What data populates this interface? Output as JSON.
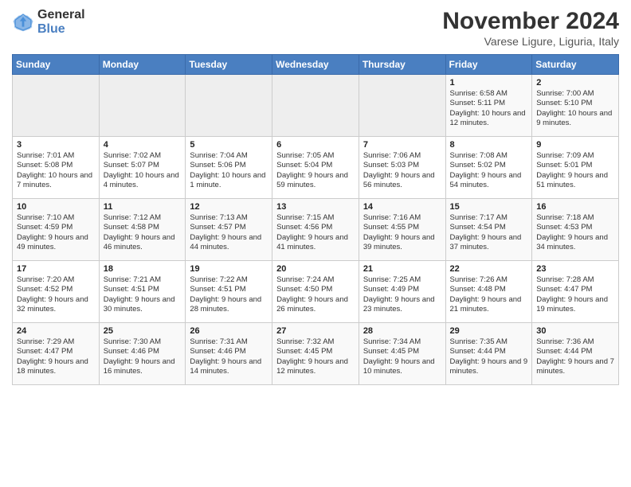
{
  "header": {
    "logo_line1": "General",
    "logo_line2": "Blue",
    "month": "November 2024",
    "location": "Varese Ligure, Liguria, Italy"
  },
  "days_of_week": [
    "Sunday",
    "Monday",
    "Tuesday",
    "Wednesday",
    "Thursday",
    "Friday",
    "Saturday"
  ],
  "weeks": [
    [
      {
        "day": "",
        "info": ""
      },
      {
        "day": "",
        "info": ""
      },
      {
        "day": "",
        "info": ""
      },
      {
        "day": "",
        "info": ""
      },
      {
        "day": "",
        "info": ""
      },
      {
        "day": "1",
        "info": "Sunrise: 6:58 AM\nSunset: 5:11 PM\nDaylight: 10 hours and 12 minutes."
      },
      {
        "day": "2",
        "info": "Sunrise: 7:00 AM\nSunset: 5:10 PM\nDaylight: 10 hours and 9 minutes."
      }
    ],
    [
      {
        "day": "3",
        "info": "Sunrise: 7:01 AM\nSunset: 5:08 PM\nDaylight: 10 hours and 7 minutes."
      },
      {
        "day": "4",
        "info": "Sunrise: 7:02 AM\nSunset: 5:07 PM\nDaylight: 10 hours and 4 minutes."
      },
      {
        "day": "5",
        "info": "Sunrise: 7:04 AM\nSunset: 5:06 PM\nDaylight: 10 hours and 1 minute."
      },
      {
        "day": "6",
        "info": "Sunrise: 7:05 AM\nSunset: 5:04 PM\nDaylight: 9 hours and 59 minutes."
      },
      {
        "day": "7",
        "info": "Sunrise: 7:06 AM\nSunset: 5:03 PM\nDaylight: 9 hours and 56 minutes."
      },
      {
        "day": "8",
        "info": "Sunrise: 7:08 AM\nSunset: 5:02 PM\nDaylight: 9 hours and 54 minutes."
      },
      {
        "day": "9",
        "info": "Sunrise: 7:09 AM\nSunset: 5:01 PM\nDaylight: 9 hours and 51 minutes."
      }
    ],
    [
      {
        "day": "10",
        "info": "Sunrise: 7:10 AM\nSunset: 4:59 PM\nDaylight: 9 hours and 49 minutes."
      },
      {
        "day": "11",
        "info": "Sunrise: 7:12 AM\nSunset: 4:58 PM\nDaylight: 9 hours and 46 minutes."
      },
      {
        "day": "12",
        "info": "Sunrise: 7:13 AM\nSunset: 4:57 PM\nDaylight: 9 hours and 44 minutes."
      },
      {
        "day": "13",
        "info": "Sunrise: 7:15 AM\nSunset: 4:56 PM\nDaylight: 9 hours and 41 minutes."
      },
      {
        "day": "14",
        "info": "Sunrise: 7:16 AM\nSunset: 4:55 PM\nDaylight: 9 hours and 39 minutes."
      },
      {
        "day": "15",
        "info": "Sunrise: 7:17 AM\nSunset: 4:54 PM\nDaylight: 9 hours and 37 minutes."
      },
      {
        "day": "16",
        "info": "Sunrise: 7:18 AM\nSunset: 4:53 PM\nDaylight: 9 hours and 34 minutes."
      }
    ],
    [
      {
        "day": "17",
        "info": "Sunrise: 7:20 AM\nSunset: 4:52 PM\nDaylight: 9 hours and 32 minutes."
      },
      {
        "day": "18",
        "info": "Sunrise: 7:21 AM\nSunset: 4:51 PM\nDaylight: 9 hours and 30 minutes."
      },
      {
        "day": "19",
        "info": "Sunrise: 7:22 AM\nSunset: 4:51 PM\nDaylight: 9 hours and 28 minutes."
      },
      {
        "day": "20",
        "info": "Sunrise: 7:24 AM\nSunset: 4:50 PM\nDaylight: 9 hours and 26 minutes."
      },
      {
        "day": "21",
        "info": "Sunrise: 7:25 AM\nSunset: 4:49 PM\nDaylight: 9 hours and 23 minutes."
      },
      {
        "day": "22",
        "info": "Sunrise: 7:26 AM\nSunset: 4:48 PM\nDaylight: 9 hours and 21 minutes."
      },
      {
        "day": "23",
        "info": "Sunrise: 7:28 AM\nSunset: 4:47 PM\nDaylight: 9 hours and 19 minutes."
      }
    ],
    [
      {
        "day": "24",
        "info": "Sunrise: 7:29 AM\nSunset: 4:47 PM\nDaylight: 9 hours and 18 minutes."
      },
      {
        "day": "25",
        "info": "Sunrise: 7:30 AM\nSunset: 4:46 PM\nDaylight: 9 hours and 16 minutes."
      },
      {
        "day": "26",
        "info": "Sunrise: 7:31 AM\nSunset: 4:46 PM\nDaylight: 9 hours and 14 minutes."
      },
      {
        "day": "27",
        "info": "Sunrise: 7:32 AM\nSunset: 4:45 PM\nDaylight: 9 hours and 12 minutes."
      },
      {
        "day": "28",
        "info": "Sunrise: 7:34 AM\nSunset: 4:45 PM\nDaylight: 9 hours and 10 minutes."
      },
      {
        "day": "29",
        "info": "Sunrise: 7:35 AM\nSunset: 4:44 PM\nDaylight: 9 hours and 9 minutes."
      },
      {
        "day": "30",
        "info": "Sunrise: 7:36 AM\nSunset: 4:44 PM\nDaylight: 9 hours and 7 minutes."
      }
    ]
  ]
}
